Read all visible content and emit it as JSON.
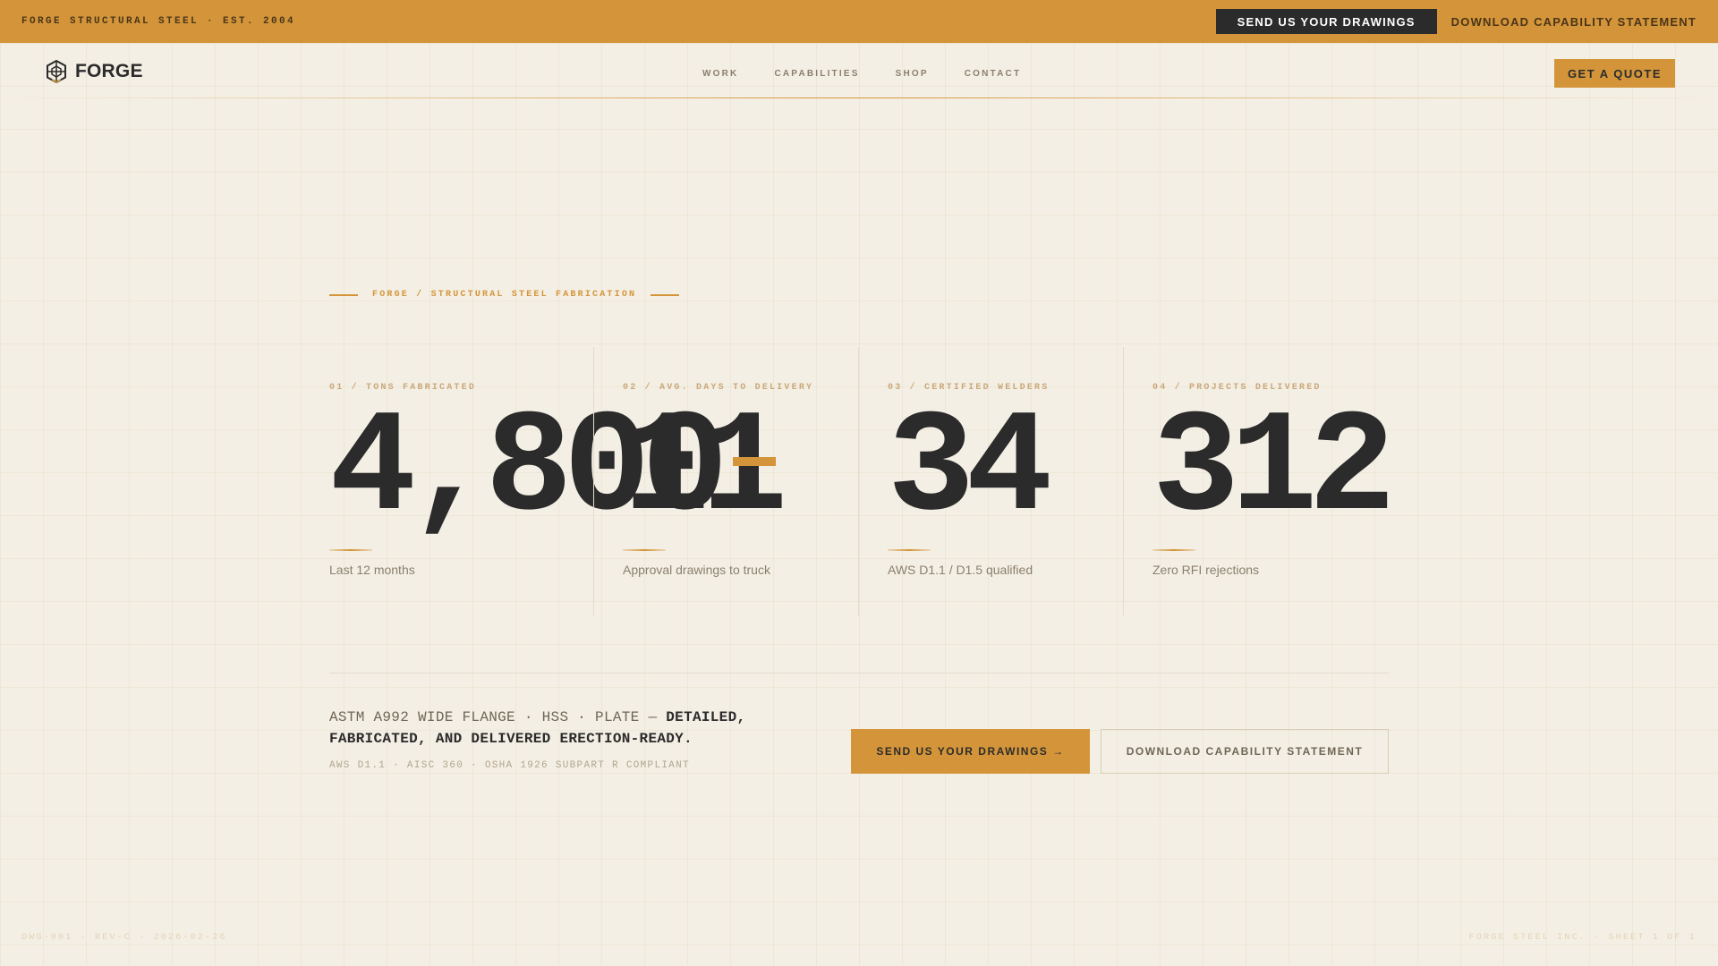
{
  "topbar": {
    "brand": "FORGE STRUCTURAL STEEL · EST. 2004",
    "send_drawings": "SEND US YOUR DRAWINGS",
    "download_statement": "DOWNLOAD CAPABILITY STATEMENT"
  },
  "header": {
    "logo_icon": "hex-frame-icon",
    "logo_text": "FORGE",
    "nav": [
      {
        "label": "WORK"
      },
      {
        "label": "CAPABILITIES"
      },
      {
        "label": "SHOP"
      },
      {
        "label": "CONTACT"
      }
    ],
    "quote_button": "GET A QUOTE"
  },
  "hero": {
    "eyebrow": "FORGE / STRUCTURAL STEEL FABRICATION",
    "stats": [
      {
        "label": "01 / TONS FABRICATED",
        "value": "4,800",
        "caption": "Last 12 months"
      },
      {
        "label": "02 / AVG. DAYS TO DELIVERY",
        "value": "11",
        "caption": "Approval drawings to truck"
      },
      {
        "label": "03 / CERTIFIED WELDERS",
        "value": "34",
        "caption": "AWS D1.1 / D1.5 qualified"
      },
      {
        "label": "04 / PROJECTS DELIVERED",
        "value": "312",
        "caption": "Zero RFI rejections"
      }
    ]
  },
  "cta": {
    "tagline_plain": "ASTM A992 WIDE FLANGE · HSS · PLATE — ",
    "tagline_bold": "DETAILED, FABRICATED, AND DELIVERED ERECTION-READY.",
    "compliance": "AWS D1.1 · AISC 360 · OSHA 1926 SUBPART R COMPLIANT",
    "primary": "SEND US YOUR DRAWINGS →",
    "secondary": "DOWNLOAD CAPABILITY STATEMENT"
  },
  "footer": {
    "left": "DWG-001 · REV-C · 2026-02-26",
    "right": "FORGE STEEL INC. · SHEET 1 OF 1"
  },
  "colors": {
    "accent": "#d4953a",
    "ink": "#2b2b2b",
    "background": "#f4efe4"
  }
}
